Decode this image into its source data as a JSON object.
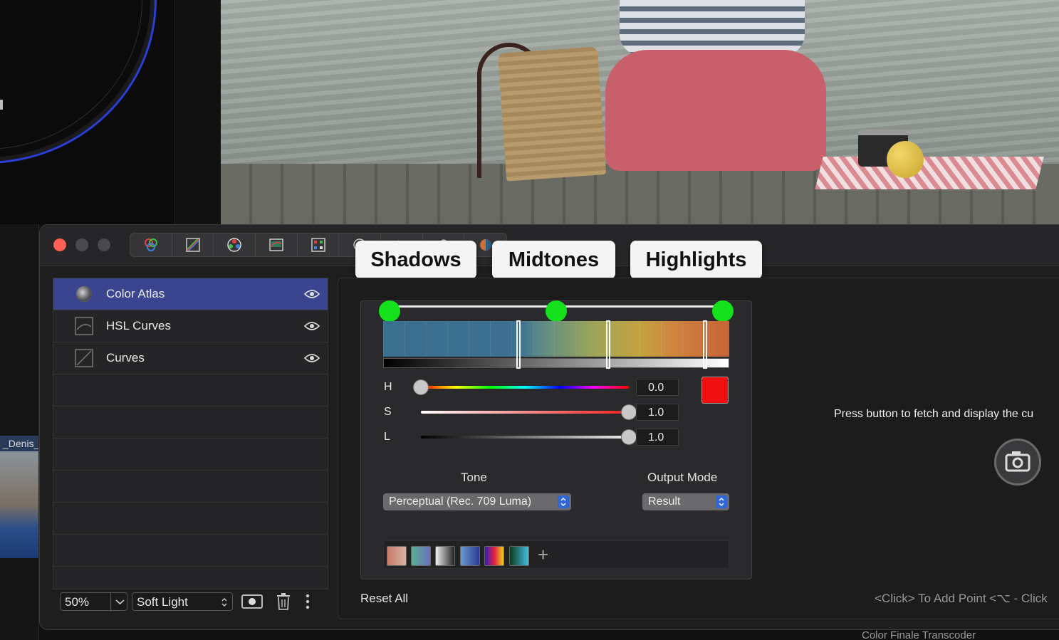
{
  "viewer": {
    "clip_label": "_Denis_"
  },
  "toolbar": {
    "tools": [
      {
        "icon": "color-board-icon"
      },
      {
        "icon": "curves-tool-icon"
      },
      {
        "icon": "color-wheels-icon"
      },
      {
        "icon": "hsl-curves-tool-icon"
      },
      {
        "icon": "color-atlas-tool-icon"
      },
      {
        "icon": "circle-tool-icon"
      },
      {
        "icon": "arrow-tool-icon"
      },
      {
        "icon": "pin-tool-icon"
      },
      {
        "icon": "mask-tool-icon"
      }
    ]
  },
  "tabs": {
    "shadows": "Shadows",
    "midtones": "Midtones",
    "highlights": "Highlights"
  },
  "layers": [
    {
      "name": "Color Atlas",
      "icon": "color-atlas-icon",
      "active": true
    },
    {
      "name": "HSL Curves",
      "icon": "hsl-curves-icon",
      "active": false
    },
    {
      "name": "Curves",
      "icon": "curves-icon",
      "active": false
    }
  ],
  "layer_controls": {
    "opacity": "50%",
    "blend_mode": "Soft Light"
  },
  "tone_range": {
    "handles": [
      0.0,
      0.5,
      1.0
    ],
    "markers": [
      0.39,
      0.65,
      0.93
    ]
  },
  "hsl": {
    "h": {
      "label": "H",
      "value": "0.0",
      "level": 0.0
    },
    "s": {
      "label": "S",
      "value": "1.0",
      "level": 1.0
    },
    "l": {
      "label": "L",
      "value": "1.0",
      "level": 1.0
    },
    "swatch_color": "#f01010"
  },
  "tone": {
    "label": "Tone",
    "value": "Perceptual (Rec. 709 Luma)"
  },
  "output_mode": {
    "label": "Output Mode",
    "value": "Result"
  },
  "actions": {
    "reset_all": "Reset All"
  },
  "fetch": {
    "message": "Press button to fetch and display the cu"
  },
  "hint": {
    "text": "<Click> To Add Point <⌥ - Click"
  },
  "below": {
    "title": "Color Finale Transcoder"
  },
  "colors": {
    "accent": "#3a448f",
    "handle": "#14e01c",
    "close": "#fe5f57",
    "dropdown_arrow": "#3166d6"
  }
}
